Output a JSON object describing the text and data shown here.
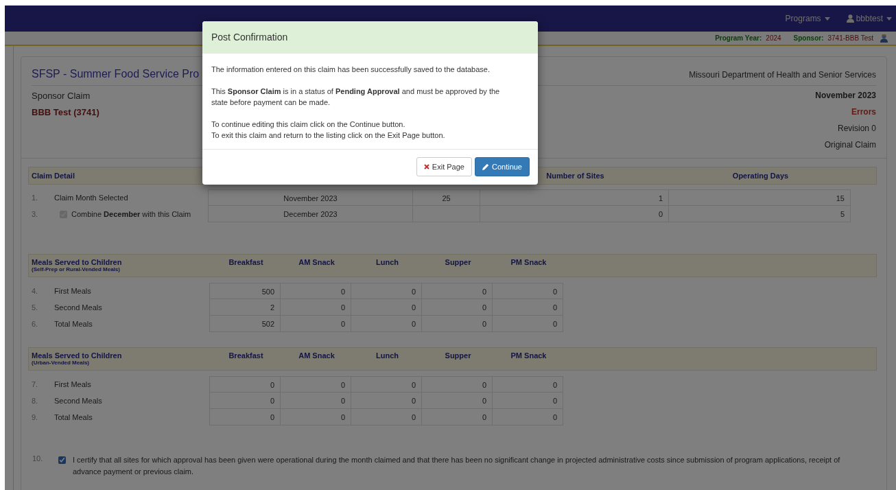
{
  "navbar": {
    "menus": [
      {
        "label": "Programs",
        "kind": "menu"
      },
      {
        "label": "bbbtest",
        "kind": "user"
      }
    ]
  },
  "context_bar": {
    "program_year_label": "Program Year:",
    "program_year": "2024",
    "sponsor_label": "Sponsor:",
    "sponsor": "3741-BBB Test"
  },
  "claim_header": {
    "title": "SFSP - Summer Food Service Pro",
    "subtitle": "Sponsor Claim",
    "sponsor_name": "BBB Test  (3741)",
    "agency": "Missouri Department of Health and Senior Services",
    "month": "November 2023",
    "status": "Errors",
    "revision": "Revision 0",
    "claim_type": "Original Claim"
  },
  "claim_detail": {
    "columns": [
      "Claim Detail",
      "",
      "",
      "Number of Sites",
      "Operating Days"
    ],
    "rows": [
      {
        "kind": "text",
        "number": "1.",
        "label": "Claim Month Selected",
        "month": "November 2023",
        "column_3": "25",
        "sites": "1",
        "days": "15"
      },
      {
        "kind": "checkbox",
        "number": "3.",
        "label": "Combine **December** with this Claim",
        "checked": true,
        "disabled": true,
        "month": "December 2023",
        "sites": "0",
        "days": "5"
      }
    ]
  },
  "meals_tables": [
    {
      "title": "Meals Served to Children",
      "subtitle": "(Self-Prep or Rural-Vended Meals)",
      "columns": [
        "Breakfast",
        "AM Snack",
        "Lunch",
        "Supper",
        "PM Snack"
      ],
      "rows": [
        {
          "number": "4.",
          "label": "First Meals",
          "values": [
            "500",
            "0",
            "0",
            "0",
            "0"
          ]
        },
        {
          "number": "5.",
          "label": "Second Meals",
          "values": [
            "2",
            "0",
            "0",
            "0",
            "0"
          ]
        },
        {
          "number": "6.",
          "label": "Total Meals",
          "values": [
            "502",
            "0",
            "0",
            "0",
            "0"
          ]
        }
      ]
    },
    {
      "title": "Meals Served to Children",
      "subtitle": "(Urban-Vended Meals)",
      "columns": [
        "Breakfast",
        "AM Snack",
        "Lunch",
        "Supper",
        "PM Snack"
      ],
      "rows": [
        {
          "number": "7.",
          "label": "First Meals",
          "values": [
            "0",
            "0",
            "0",
            "0",
            "0"
          ]
        },
        {
          "number": "8.",
          "label": "Second Meals",
          "values": [
            "0",
            "0",
            "0",
            "0",
            "0"
          ]
        },
        {
          "number": "9.",
          "label": "Total Meals",
          "values": [
            "0",
            "0",
            "0",
            "0",
            "0"
          ]
        }
      ]
    }
  ],
  "certification": {
    "number": "10.",
    "checked": true,
    "text": "I certify that all sites for which approval has been given were operational during the month claimed and that there has been no significant change in projected administrative costs since submission of program applications, receipt of advance payment or previous claim."
  },
  "modal": {
    "title": "Post Confirmation",
    "paragraphs": [
      [
        "The information entered on this claim has been successfully saved to the database."
      ],
      [
        "This **Sponsor Claim** is in a status of **Pending Approval** and must be approved by the state before payment can be made."
      ],
      [
        "To continue editing this claim click on the Continue button.",
        "To exit this claim and return to the listing click on the Exit Page button."
      ]
    ],
    "buttons": [
      {
        "label": "Exit Page",
        "kind": "default"
      },
      {
        "label": "Continue",
        "kind": "primary"
      }
    ]
  }
}
